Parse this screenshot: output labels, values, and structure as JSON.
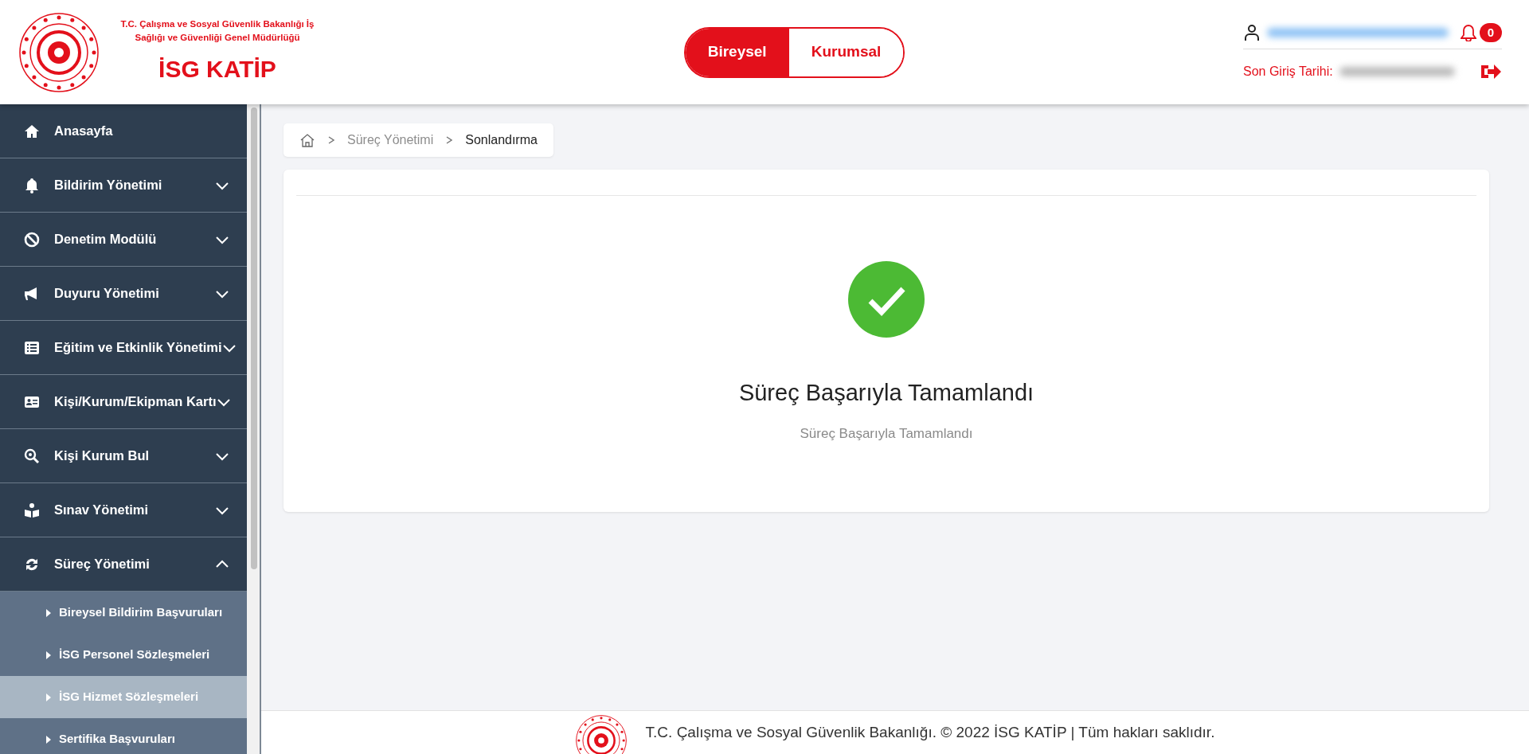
{
  "header": {
    "ministry": "T.C. Çalışma ve Sosyal Güvenlik Bakanlığı İş Sağlığı ve Güvenliği Genel Müdürlüğü",
    "app_title": "İSG KATİP",
    "mode_toggle": [
      {
        "label": "Bireysel",
        "selected": true
      },
      {
        "label": "Kurumsal",
        "selected": false
      }
    ],
    "notifications": "0",
    "last_login_label": "Son Giriş Tarihi:"
  },
  "sidebar": {
    "items": [
      {
        "label": "Anasayfa",
        "kind": "link"
      },
      {
        "label": "Bildirim Yönetimi",
        "kind": "menu",
        "expanded": false
      },
      {
        "label": "Denetim Modülü",
        "kind": "menu",
        "expanded": false
      },
      {
        "label": "Duyuru Yönetimi",
        "kind": "menu",
        "expanded": false
      },
      {
        "label": "Eğitim ve Etkinlik Yönetimi",
        "kind": "menu",
        "expanded": false
      },
      {
        "label": "Kişi/Kurum/Ekipman Kartı",
        "kind": "menu",
        "expanded": false
      },
      {
        "label": "Kişi Kurum Bul",
        "kind": "menu",
        "expanded": false
      },
      {
        "label": "Sınav Yönetimi",
        "kind": "menu",
        "expanded": false
      },
      {
        "label": "Süreç Yönetimi",
        "kind": "menu",
        "expanded": true,
        "children": [
          {
            "label": "Bireysel Bildirim Başvuruları",
            "selected": false
          },
          {
            "label": "İSG Personel Sözleşmeleri",
            "selected": false
          },
          {
            "label": "İSG Hizmet Sözleşmeleri",
            "selected": true
          },
          {
            "label": "Sertifika Başvuruları",
            "selected": false
          }
        ]
      }
    ]
  },
  "breadcrumb": [
    "Süreç Yönetimi",
    "Sonlandırma"
  ],
  "result": {
    "title": "Süreç Başarıyla Tamamlandı",
    "message": "Süreç Başarıyla Tamamlandı"
  },
  "footer": "T.C. Çalışma ve Sosyal Güvenlik Bakanlığı. © 2022 İSG KATİP | Tüm hakları saklıdır."
}
